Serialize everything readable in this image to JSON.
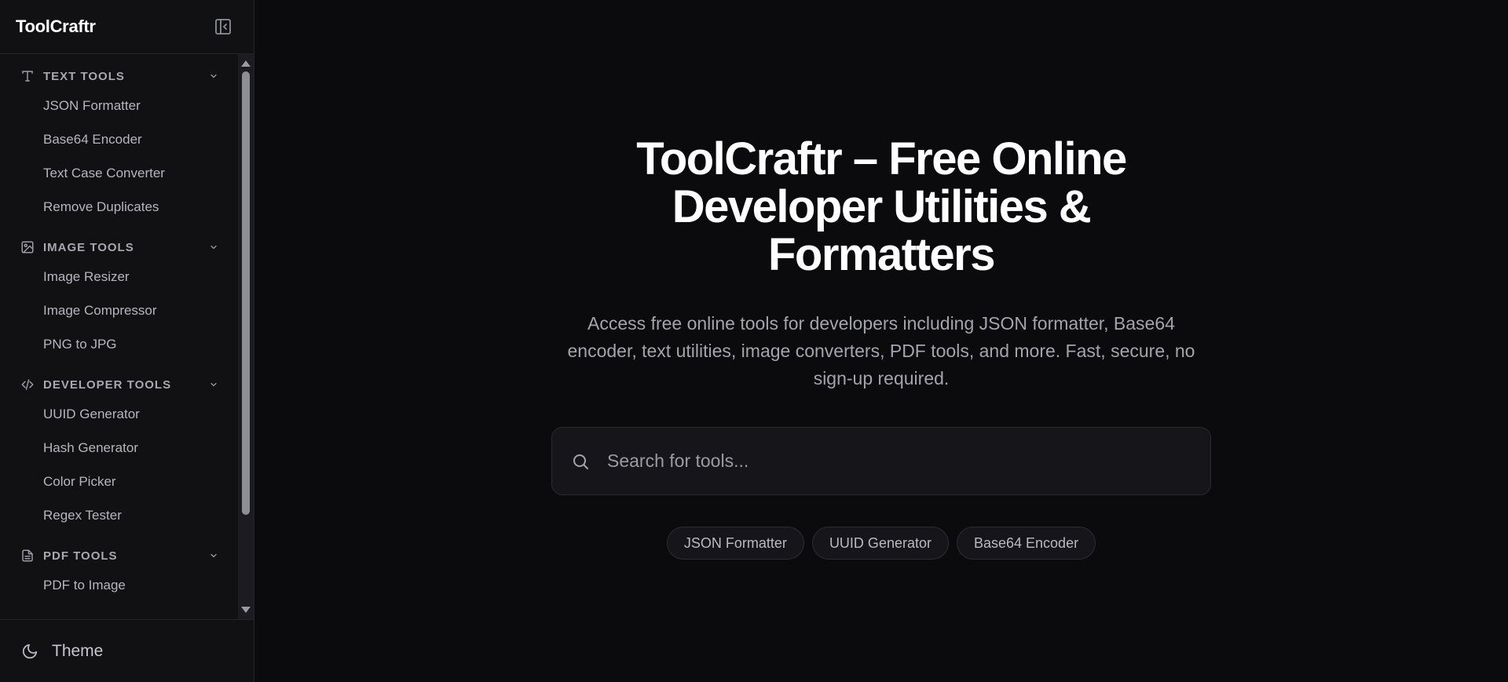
{
  "sidebar": {
    "brand": "ToolCraftr",
    "groups": [
      {
        "label": "TEXT TOOLS",
        "icon": "text-icon",
        "items": [
          "JSON Formatter",
          "Base64 Encoder",
          "Text Case Converter",
          "Remove Duplicates"
        ]
      },
      {
        "label": "IMAGE TOOLS",
        "icon": "image-icon",
        "items": [
          "Image Resizer",
          "Image Compressor",
          "PNG to JPG"
        ]
      },
      {
        "label": "DEVELOPER TOOLS",
        "icon": "code-icon",
        "items": [
          "UUID Generator",
          "Hash Generator",
          "Color Picker",
          "Regex Tester"
        ]
      },
      {
        "label": "PDF TOOLS",
        "icon": "file-text-icon",
        "items": [
          "PDF to Image"
        ]
      }
    ],
    "footer": {
      "theme_label": "Theme",
      "icon": "moon-icon"
    }
  },
  "hero": {
    "title": "ToolCraftr – Free Online Developer Utilities & Formatters",
    "subtitle": "Access free online tools for developers including JSON formatter, Base64 encoder, text utilities, image converters, PDF tools, and more. Fast, secure, no sign-up required.",
    "search_placeholder": "Search for tools...",
    "chips": [
      "JSON Formatter",
      "UUID Generator",
      "Base64 Encoder"
    ]
  },
  "colors": {
    "background": "#0b0b0e",
    "sidebar": "#111114",
    "text_primary": "#ffffff",
    "text_muted": "#a3a4ac"
  }
}
